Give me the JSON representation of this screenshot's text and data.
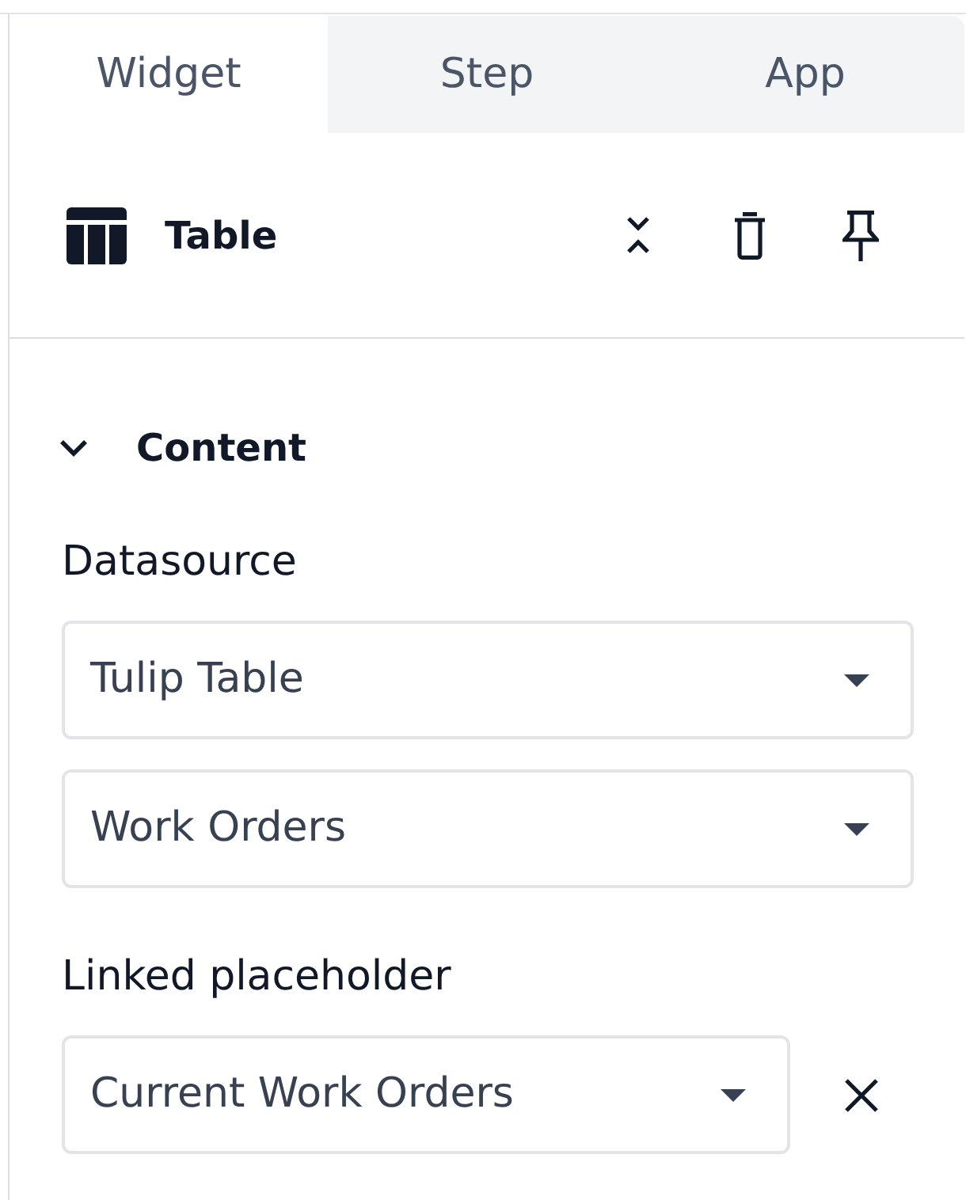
{
  "tabs": [
    {
      "label": "Widget",
      "selected": true
    },
    {
      "label": "Step",
      "selected": false
    },
    {
      "label": "App",
      "selected": false
    }
  ],
  "widget_header": {
    "title": "Table"
  },
  "section": {
    "title": "Content",
    "expanded": true,
    "fields": [
      {
        "kind": "select",
        "label": "Datasource",
        "value": "Tulip Table"
      },
      {
        "kind": "select",
        "value": "Work Orders"
      },
      {
        "kind": "select",
        "label": "Linked placeholder",
        "value": "Current Work Orders",
        "clearable": true
      }
    ]
  }
}
